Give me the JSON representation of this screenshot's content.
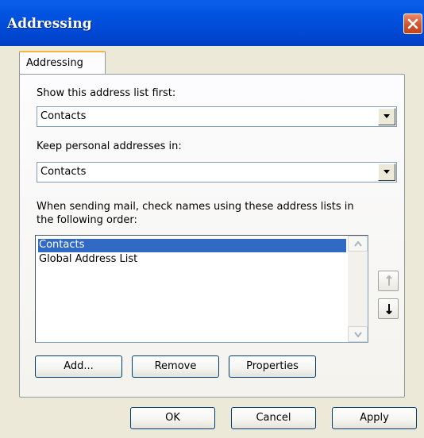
{
  "window": {
    "title": "Addressing",
    "close_icon": "close-icon",
    "accent": "#0154e0"
  },
  "tab": {
    "label": "Addressing"
  },
  "show_first": {
    "label": "Show this address list first:",
    "value": "Contacts"
  },
  "keep_personal": {
    "label": "Keep personal addresses in:",
    "value": "Contacts"
  },
  "order": {
    "label_line1": "When sending mail, check names using these address lists in",
    "label_line2": "the following order:",
    "items": [
      "Contacts",
      "Global Address List"
    ],
    "selected_index": 0
  },
  "list_buttons": {
    "add": "Add...",
    "remove": "Remove",
    "properties": "Properties"
  },
  "dialog_buttons": {
    "ok": "OK",
    "cancel": "Cancel",
    "apply": "Apply"
  },
  "colors": {
    "selection": "#316ac5",
    "close_button": "#d2532c",
    "face": "#ece9d8"
  }
}
